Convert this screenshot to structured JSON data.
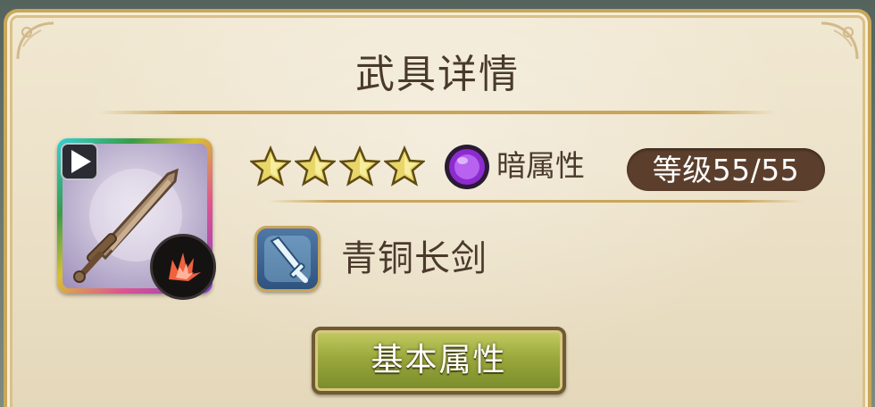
{
  "panel": {
    "title": "武具详情"
  },
  "weapon": {
    "icon": "bronze-sword-icon",
    "rank_badge_icon": "play-arrow-icon",
    "skill_badge_icon": "burst-icon",
    "rarity_stars": 4,
    "element": {
      "icon": "dark-orb-icon",
      "label": "暗属性",
      "color": "#8d2bd0"
    },
    "level_label": "等级55/55",
    "type_icon": "sword-type-icon",
    "name": "青铜长剑"
  },
  "actions": {
    "basic_stats_label": "基本属性"
  },
  "colors": {
    "panel_bg": "#ebe0c6",
    "gold_trim": "#c9a55a",
    "text_brown": "#4a3a2c",
    "level_pill": "#5b3f2c",
    "button_green": "#9aa93c"
  }
}
